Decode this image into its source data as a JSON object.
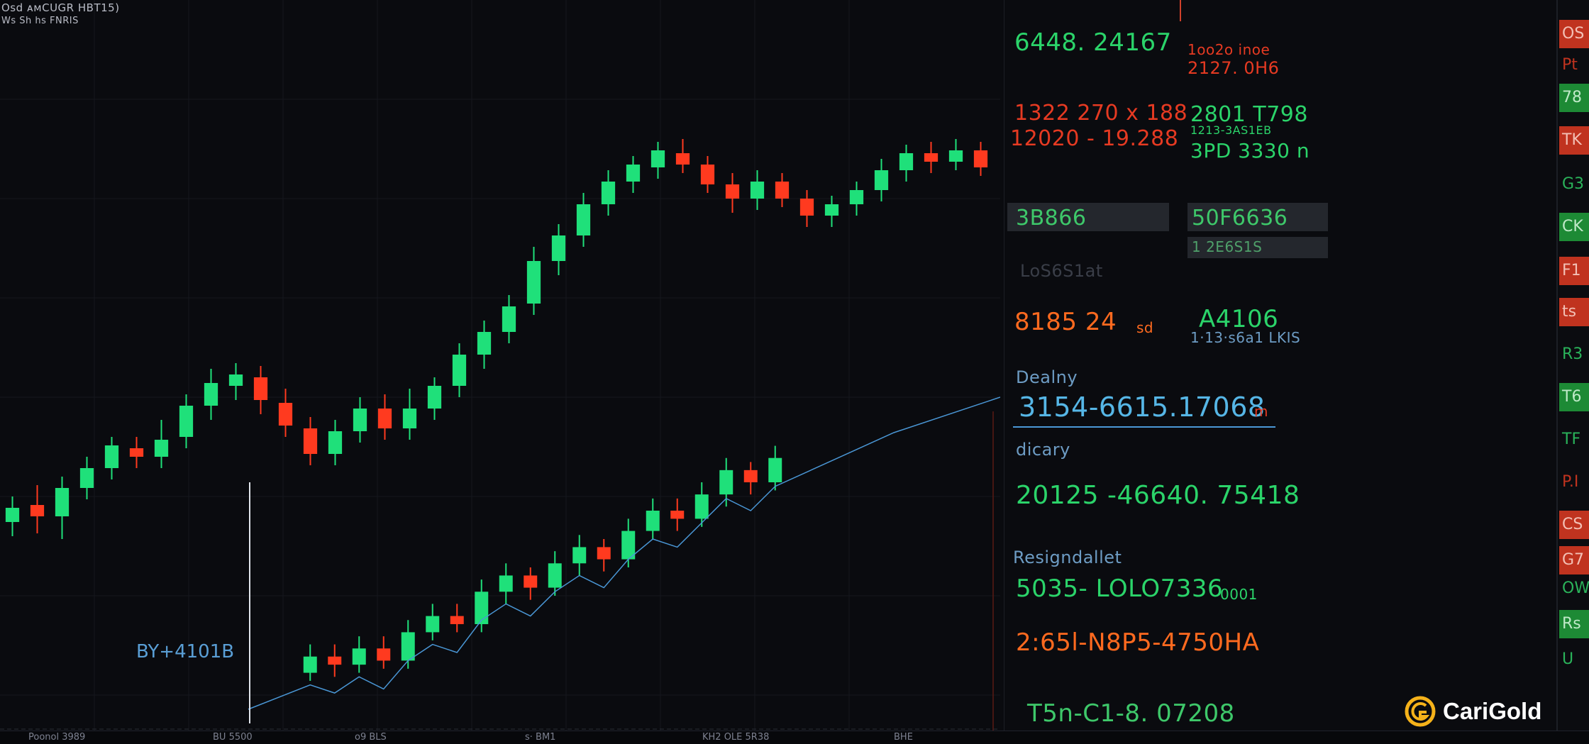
{
  "header": {
    "symbol_line": "Osd ᴀᴍCUGR HBT15)",
    "sub_line": "Ws Sh hs FNRIS"
  },
  "annotation_label": "BY+4101B",
  "ticker": {
    "row1_green": "6448. 24167",
    "row1_red_top": "1oo2o   inoe",
    "row1_red_bottom": "2127. 0H6",
    "row2_red_top": "1322 270 x 188",
    "row2_red_bottom": "12020 - 19.288",
    "row2_green_top": "2801 T798",
    "row2_green_mid": "1213-3AS1EB",
    "row2_green_bottom": "3PD  3330 n",
    "box_left": "3B866",
    "box_right": "50F6636",
    "box_right_sub": "1  2E6S1S",
    "faded_label": "LoS6S1at",
    "price_orange": "8185 24",
    "price_orange_suffix": "sd",
    "price_green": "A4106",
    "price_green_sub": "1·13·s6a1 LKIS",
    "label_dealing": "Dealny",
    "main_quote": "3154-6615.17068",
    "main_quote_suffix": "m",
    "label_dicary": "dicary",
    "quote_2": "20125 -46640. 75418",
    "label_resign": "Resigndallet",
    "quote_3": "5035- LOLO7336",
    "quote_3_suffix": "0001",
    "quote_4": "2:65l-N8P5-4750HA",
    "quote_5": "T5n-C1-8. 07208"
  },
  "x_axis_ticks": [
    "Poonol 3989",
    "BU 5500",
    "o9  BLS",
    "s·  BM1",
    "KH2    OLE 5R38",
    "BHE"
  ],
  "right_scale_tags": [
    {
      "text": "OS",
      "bg": "#c0331f",
      "fg": "#f3c0b5"
    },
    {
      "text": "Pt",
      "bg": "#0b0c10",
      "fg": "#c0331f"
    },
    {
      "text": "78",
      "bg": "#1d8a35",
      "fg": "#bfe9c8"
    },
    {
      "text": "TK",
      "bg": "#c0331f",
      "fg": "#f3c0b5"
    },
    {
      "text": "G3",
      "bg": "#0b0c10",
      "fg": "#2ab35a"
    },
    {
      "text": "CK",
      "bg": "#1d8a35",
      "fg": "#bfe9c8"
    },
    {
      "text": "F1",
      "bg": "#c0331f",
      "fg": "#f3c0b5"
    },
    {
      "text": "ts",
      "bg": "#c0331f",
      "fg": "#f3c0b5"
    },
    {
      "text": "R3",
      "bg": "#0b0c10",
      "fg": "#2ab35a"
    },
    {
      "text": "T6",
      "bg": "#1d8a35",
      "fg": "#bfe9c8"
    },
    {
      "text": "TF",
      "bg": "#0b0c10",
      "fg": "#2ab35a"
    },
    {
      "text": "P.I",
      "bg": "#0b0c10",
      "fg": "#c0331f"
    },
    {
      "text": "CS",
      "bg": "#c0331f",
      "fg": "#f3c0b5"
    },
    {
      "text": "G7",
      "bg": "#c0331f",
      "fg": "#f3c0b5"
    },
    {
      "text": "OW",
      "bg": "#0b0c10",
      "fg": "#2ab35a"
    },
    {
      "text": "Rs",
      "bg": "#1d8a35",
      "fg": "#bfe9c8"
    },
    {
      "text": "U",
      "bg": "#0b0c10",
      "fg": "#2ab35a"
    }
  ],
  "logo": {
    "text": "CariGold"
  },
  "colors": {
    "up": "#1fe07a",
    "down": "#ff3a1f",
    "accent_blue": "#4a97d6",
    "background": "#0a0b0f",
    "orange": "#ff6a1f"
  },
  "chart_data": [
    {
      "type": "candlestick",
      "name_hint": "upper",
      "grid": true,
      "candles": [
        [
          372,
          382,
          362,
          390
        ],
        [
          384,
          376,
          364,
          398
        ],
        [
          376,
          396,
          360,
          404
        ],
        [
          396,
          410,
          388,
          418
        ],
        [
          410,
          426,
          402,
          432
        ],
        [
          424,
          418,
          410,
          432
        ],
        [
          418,
          430,
          410,
          444
        ],
        [
          432,
          454,
          424,
          462
        ],
        [
          454,
          470,
          444,
          480
        ],
        [
          468,
          476,
          458,
          484
        ],
        [
          474,
          458,
          448,
          482
        ],
        [
          456,
          440,
          432,
          466
        ],
        [
          438,
          420,
          412,
          446
        ],
        [
          420,
          436,
          412,
          444
        ],
        [
          436,
          452,
          428,
          460
        ],
        [
          452,
          438,
          430,
          462
        ],
        [
          438,
          452,
          430,
          466
        ],
        [
          452,
          468,
          444,
          474
        ],
        [
          468,
          490,
          460,
          498
        ],
        [
          490,
          506,
          480,
          514
        ],
        [
          506,
          524,
          498,
          532
        ],
        [
          526,
          556,
          518,
          566
        ],
        [
          556,
          574,
          546,
          582
        ],
        [
          574,
          596,
          566,
          604
        ],
        [
          596,
          612,
          588,
          620
        ],
        [
          612,
          624,
          604,
          630
        ],
        [
          622,
          634,
          614,
          640
        ],
        [
          632,
          624,
          618,
          642
        ],
        [
          624,
          610,
          604,
          630
        ],
        [
          610,
          600,
          590,
          618
        ],
        [
          600,
          612,
          592,
          620
        ],
        [
          612,
          600,
          594,
          618
        ],
        [
          600,
          588,
          580,
          606
        ],
        [
          588,
          596,
          580,
          602
        ],
        [
          596,
          606,
          588,
          612
        ],
        [
          606,
          620,
          598,
          628
        ],
        [
          620,
          632,
          612,
          638
        ],
        [
          632,
          626,
          618,
          640
        ],
        [
          626,
          634,
          620,
          642
        ],
        [
          634,
          622,
          616,
          640
        ]
      ]
    },
    {
      "type": "candlestick",
      "name_hint": "lower",
      "grid": true,
      "candles": [
        [
          18,
          26,
          14,
          32
        ],
        [
          26,
          22,
          16,
          32
        ],
        [
          22,
          30,
          18,
          36
        ],
        [
          30,
          24,
          20,
          36
        ],
        [
          24,
          38,
          20,
          44
        ],
        [
          38,
          46,
          34,
          52
        ],
        [
          46,
          42,
          38,
          52
        ],
        [
          42,
          58,
          38,
          64
        ],
        [
          58,
          66,
          52,
          72
        ],
        [
          66,
          60,
          54,
          70
        ],
        [
          60,
          72,
          56,
          78
        ],
        [
          72,
          80,
          66,
          86
        ],
        [
          80,
          74,
          68,
          84
        ],
        [
          74,
          88,
          70,
          94
        ],
        [
          88,
          98,
          84,
          104
        ],
        [
          98,
          94,
          88,
          104
        ],
        [
          94,
          106,
          90,
          112
        ],
        [
          106,
          118,
          100,
          124
        ],
        [
          118,
          112,
          106,
          122
        ],
        [
          112,
          124,
          108,
          130
        ]
      ]
    }
  ]
}
